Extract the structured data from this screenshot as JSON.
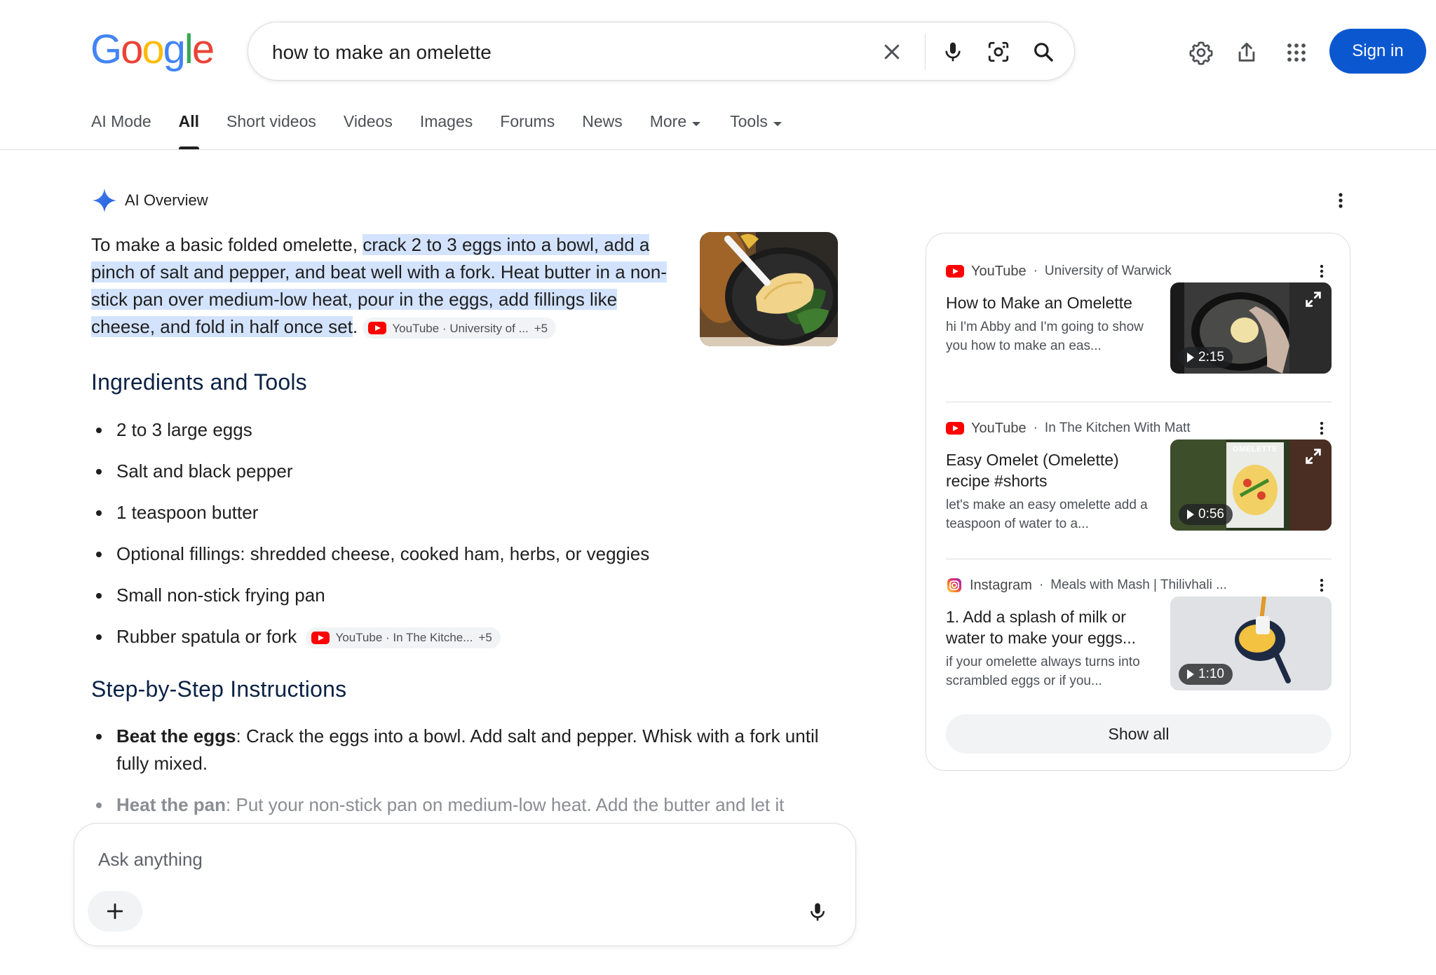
{
  "logo": {
    "letters": [
      "G",
      "o",
      "o",
      "g",
      "l",
      "e"
    ]
  },
  "search": {
    "query": "how to make an omelette",
    "placeholder": ""
  },
  "header": {
    "sign_in": "Sign in"
  },
  "tabs": [
    {
      "label": "AI Mode"
    },
    {
      "label": "All",
      "active": true
    },
    {
      "label": "Short videos"
    },
    {
      "label": "Videos"
    },
    {
      "label": "Images"
    },
    {
      "label": "Forums"
    },
    {
      "label": "News"
    },
    {
      "label": "More",
      "dropdown": true
    },
    {
      "label": "Tools",
      "dropdown": true
    }
  ],
  "ai_overview": {
    "heading": "AI Overview",
    "intro_plain": "To make a basic folded omelette, ",
    "intro_highlight": "crack 2 to 3 eggs into a bowl, add a pinch of salt and pepper, and beat well with a fork. Heat butter in a non-stick pan over medium-low heat, pour in the eggs, add fillings like cheese, and fold in half once set",
    "intro_end": ".",
    "intro_chip": {
      "label": "YouTube · University of ...",
      "count": "+5"
    },
    "ingredients_heading": "Ingredients and Tools",
    "ingredients": [
      "2 to 3 large eggs",
      "Salt and black pepper",
      "1 teaspoon butter",
      "Optional fillings: shredded cheese, cooked ham, herbs, or veggies",
      "Small non-stick frying pan",
      "Rubber spatula or fork"
    ],
    "ingredients_chip": {
      "label": "YouTube · In The Kitche...",
      "count": "+5"
    },
    "steps_heading": "Step-by-Step Instructions",
    "steps": [
      {
        "title": "Beat the eggs",
        "text": ": Crack the eggs into a bowl. Add salt and pepper. Whisk with a fork until fully mixed."
      },
      {
        "title": "Heat the pan",
        "text": ": Put your non-stick pan on medium-low heat. Add the butter and let it"
      }
    ]
  },
  "sources": [
    {
      "platform": "YouTube",
      "channel": "University of Warwick",
      "title": "How to Make an Omelette",
      "snippet": "hi I'm Abby and I'm going to show you how to make an eas...",
      "duration": "2:15"
    },
    {
      "platform": "YouTube",
      "channel": "In The Kitchen With Matt",
      "title": "Easy Omelet (Omelette) recipe #shorts",
      "snippet": "let's make an easy omelette add a teaspoon of water to a...",
      "duration": "0:56",
      "thumb_caption": "OMELETTE"
    },
    {
      "platform": "Instagram",
      "channel": "Meals with Mash | Thilivhali ...",
      "title": "1. Add a splash of milk or water to make your eggs...",
      "snippet": "if your omelette always turns into scrambled eggs or if you...",
      "duration": "1:10"
    }
  ],
  "show_all": "Show all",
  "ask": {
    "placeholder": "Ask anything"
  },
  "colors": {
    "accent": "#0b57d0",
    "highlight": "#d3e3fd",
    "heading": "#0b2245",
    "youtube": "#ff0000"
  }
}
